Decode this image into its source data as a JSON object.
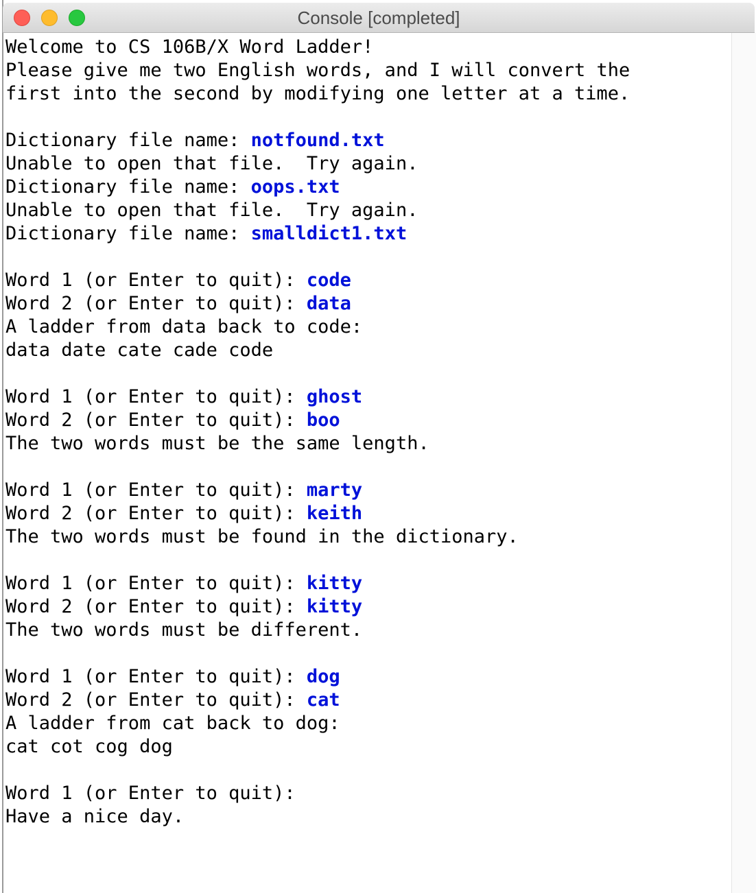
{
  "window": {
    "title": "Console [completed]"
  },
  "colors": {
    "user_input": "#0011d9",
    "output": "#000000"
  },
  "console": {
    "lines": [
      {
        "text": "Welcome to CS 106B/X Word Ladder!",
        "input": ""
      },
      {
        "text": "Please give me two English words, and I will convert the",
        "input": ""
      },
      {
        "text": "first into the second by modifying one letter at a time.",
        "input": ""
      },
      {
        "text": "Dictionary file name: ",
        "input": "notfound.txt"
      },
      {
        "text": "Unable to open that file.  Try again.",
        "input": ""
      },
      {
        "text": "Dictionary file name: ",
        "input": "oops.txt"
      },
      {
        "text": "Unable to open that file.  Try again.",
        "input": ""
      },
      {
        "text": "Dictionary file name: ",
        "input": "smalldict1.txt"
      },
      {
        "text": "Word 1 (or Enter to quit): ",
        "input": "code"
      },
      {
        "text": "Word 2 (or Enter to quit): ",
        "input": "data"
      },
      {
        "text": "A ladder from data back to code:",
        "input": ""
      },
      {
        "text": "data date cate cade code",
        "input": ""
      },
      {
        "text": "Word 1 (or Enter to quit): ",
        "input": "ghost"
      },
      {
        "text": "Word 2 (or Enter to quit): ",
        "input": "boo"
      },
      {
        "text": "The two words must be the same length.",
        "input": ""
      },
      {
        "text": "Word 1 (or Enter to quit): ",
        "input": "marty"
      },
      {
        "text": "Word 2 (or Enter to quit): ",
        "input": "keith"
      },
      {
        "text": "The two words must be found in the dictionary.",
        "input": ""
      },
      {
        "text": "Word 1 (or Enter to quit): ",
        "input": "kitty"
      },
      {
        "text": "Word 2 (or Enter to quit): ",
        "input": "kitty"
      },
      {
        "text": "The two words must be different.",
        "input": ""
      },
      {
        "text": "Word 1 (or Enter to quit): ",
        "input": "dog"
      },
      {
        "text": "Word 2 (or Enter to quit): ",
        "input": "cat"
      },
      {
        "text": "A ladder from cat back to dog:",
        "input": ""
      },
      {
        "text": "cat cot cog dog",
        "input": ""
      },
      {
        "text": "Word 1 (or Enter to quit):",
        "input": ""
      },
      {
        "text": "Have a nice day.",
        "input": ""
      }
    ]
  }
}
